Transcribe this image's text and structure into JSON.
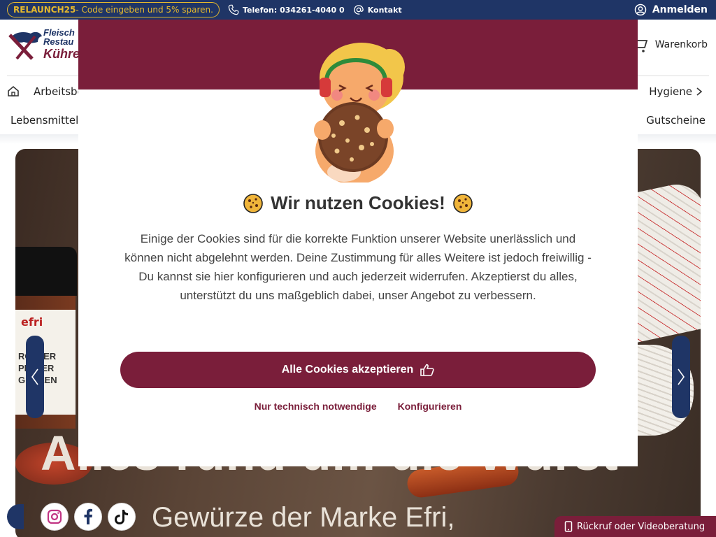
{
  "topbar": {
    "promo_code": "RELAUNCH25",
    "promo_text": " - Code eingeben und 5% sparen.",
    "phone": "Telefon: 034261-4040 0",
    "contact": "Kontakt",
    "login": "Anmelden"
  },
  "header": {
    "logo_line1": "Fleisch",
    "logo_line2": "Restau",
    "logo_line3": "Kühre",
    "cart": "Warenkorb"
  },
  "nav": {
    "item1": "Arbeitsbe",
    "item2": "Hygiene",
    "item3": "Lebensmittel",
    "item4": "Gutscheine"
  },
  "hero": {
    "jar_brand": "efri",
    "jar_line1": "RCHZER",
    "jar_line2": "PEFFER",
    "jar_line3": "GEMLEN",
    "title": "Alles rund um die Wurst",
    "subtitle": "Gewürze der Marke Efri,"
  },
  "modal": {
    "title": "Wir nutzen Cookies!",
    "text": "Einige der Cookies sind für die korrekte Funktion unserer Website unerlässlich und können nicht abgelehnt werden. Deine Zustimmung für alles Weitere ist jedoch freiwillig - Du kannst sie hier konfigurieren und auch jederzeit widerrufen. Akzeptierst du alles, unterstützt du uns maßgeblich dabei, unser Angebot zu verbessern.",
    "accept": "Alle Cookies akzeptieren",
    "necessary": "Nur technisch notwendige",
    "configure": "Konfigurieren"
  },
  "callback": "Rückruf oder Videoberatung",
  "colors": {
    "primary": "#7a1e3a",
    "navy": "#1f3566",
    "promo": "#e6b92d"
  }
}
